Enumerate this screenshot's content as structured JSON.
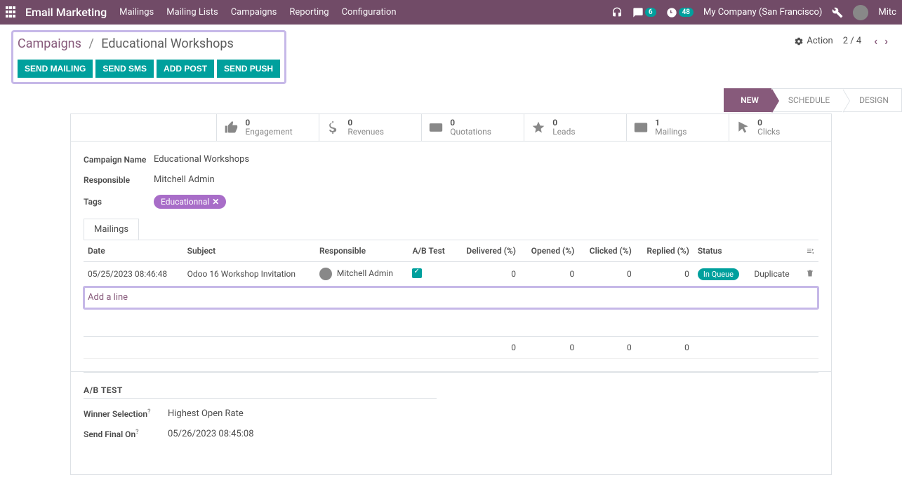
{
  "navbar": {
    "brand": "Email Marketing",
    "menus": [
      "Mailings",
      "Mailing Lists",
      "Campaigns",
      "Reporting",
      "Configuration"
    ],
    "messages_badge": "6",
    "activities_badge": "48",
    "company": "My Company (San Francisco)",
    "username_short": "Mitc"
  },
  "breadcrumb": {
    "parent": "Campaigns",
    "current": "Educational Workshops"
  },
  "buttons": {
    "send_mailing": "SEND MAILING",
    "send_sms": "SEND SMS",
    "add_post": "ADD POST",
    "send_push": "SEND PUSH"
  },
  "header_right": {
    "action": "Action",
    "pager": "2 / 4"
  },
  "pipeline": [
    "NEW",
    "SCHEDULE",
    "DESIGN"
  ],
  "pipeline_active": "NEW",
  "metrics": [
    {
      "value": "0",
      "label": "Engagement"
    },
    {
      "value": "0",
      "label": "Revenues"
    },
    {
      "value": "0",
      "label": "Quotations"
    },
    {
      "value": "0",
      "label": "Leads"
    },
    {
      "value": "1",
      "label": "Mailings"
    },
    {
      "value": "0",
      "label": "Clicks"
    }
  ],
  "fields": {
    "campaign_name_label": "Campaign Name",
    "campaign_name": "Educational Workshops",
    "responsible_label": "Responsible",
    "responsible": "Mitchell Admin",
    "tags_label": "Tags",
    "tag": "Educationnal"
  },
  "tabs": {
    "mailings": "Mailings"
  },
  "table": {
    "headers": [
      "Date",
      "Subject",
      "Responsible",
      "A/B Test",
      "Delivered (%)",
      "Opened (%)",
      "Clicked (%)",
      "Replied (%)",
      "Status"
    ],
    "rows": [
      {
        "date": "05/25/2023 08:46:48",
        "subject": "Odoo 16 Workshop Invitation",
        "responsible": "Mitchell Admin",
        "ab": true,
        "delivered": "0",
        "opened": "0",
        "clicked": "0",
        "replied": "0",
        "status": "In Queue",
        "action": "Duplicate"
      }
    ],
    "add_line": "Add a line",
    "totals": [
      "0",
      "0",
      "0",
      "0"
    ]
  },
  "ab_section": {
    "title": "A/B TEST",
    "winner_label": "Winner Selection",
    "winner_value": "Highest Open Rate",
    "final_label": "Send Final On",
    "final_value": "05/26/2023 08:45:08"
  }
}
